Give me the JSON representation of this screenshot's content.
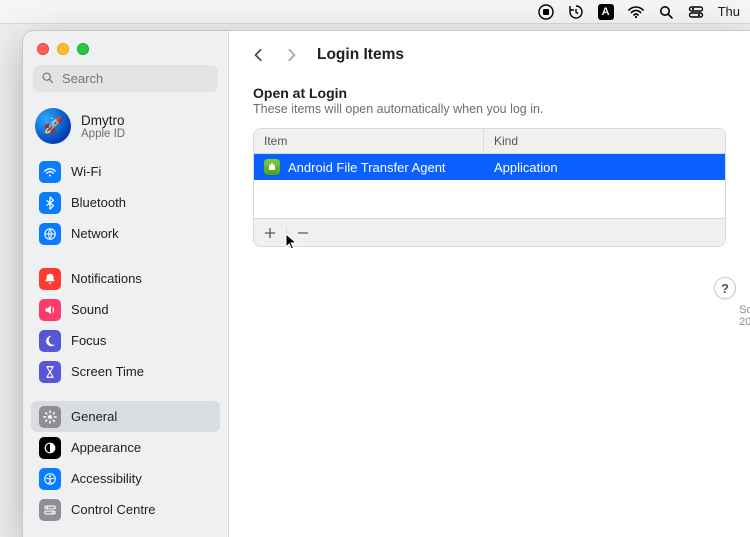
{
  "menubar": {
    "clock": "Thu",
    "icons": [
      "stop-record",
      "time-machine",
      "text-input",
      "wifi",
      "spotlight",
      "control-center"
    ]
  },
  "window": {
    "title": "Login Items"
  },
  "sidebar": {
    "search_placeholder": "Search",
    "user": {
      "name": "Dmytro",
      "sub": "Apple ID"
    },
    "groups": [
      {
        "items": [
          {
            "id": "wifi",
            "label": "Wi-Fi"
          },
          {
            "id": "bluetooth",
            "label": "Bluetooth"
          },
          {
            "id": "network",
            "label": "Network"
          }
        ]
      },
      {
        "items": [
          {
            "id": "notifications",
            "label": "Notifications"
          },
          {
            "id": "sound",
            "label": "Sound"
          },
          {
            "id": "focus",
            "label": "Focus"
          },
          {
            "id": "screentime",
            "label": "Screen Time"
          }
        ]
      },
      {
        "items": [
          {
            "id": "general",
            "label": "General",
            "selected": true
          },
          {
            "id": "appearance",
            "label": "Appearance"
          },
          {
            "id": "accessibility",
            "label": "Accessibility"
          },
          {
            "id": "controlcentre",
            "label": "Control Centre"
          }
        ]
      }
    ]
  },
  "page": {
    "section_title": "Open at Login",
    "section_sub": "These items will open automatically when you log in.",
    "columns": {
      "item": "Item",
      "kind": "Kind"
    },
    "rows": [
      {
        "name": "Android File Transfer Agent",
        "kind": "Application",
        "selected": true
      }
    ],
    "add_label": "+",
    "remove_label": "−",
    "help_label": "?"
  },
  "clipped": {
    "l1": "Sc",
    "l2": "20"
  }
}
